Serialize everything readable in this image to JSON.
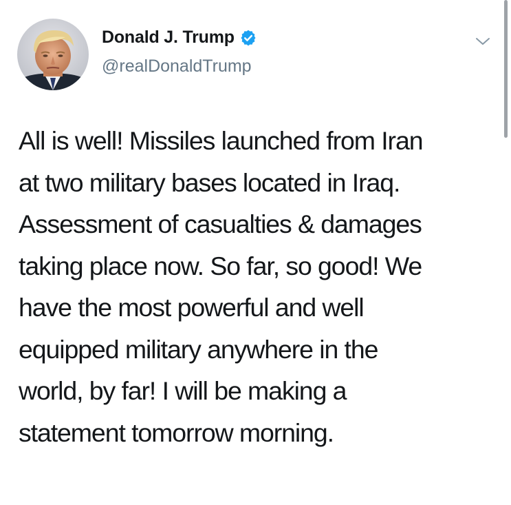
{
  "author": {
    "display_name": "Donald J. Trump",
    "handle": "@realDonaldTrump",
    "verified": true
  },
  "tweet": {
    "lines": [
      "All is well! Missiles launched from Iran",
      "at two military bases located in Iraq.",
      "Assessment of casualties & damages",
      "taking place now. So far, so good! We",
      "have the most powerful and well",
      "equipped military anywhere in the",
      "world, by far! I will be making a",
      "statement tomorrow morning."
    ]
  },
  "icons": {
    "verified": "verified-badge-icon",
    "menu": "chevron-down-icon"
  },
  "colors": {
    "text": "#14171a",
    "secondary": "#657786",
    "verified": "#1da1f2"
  }
}
